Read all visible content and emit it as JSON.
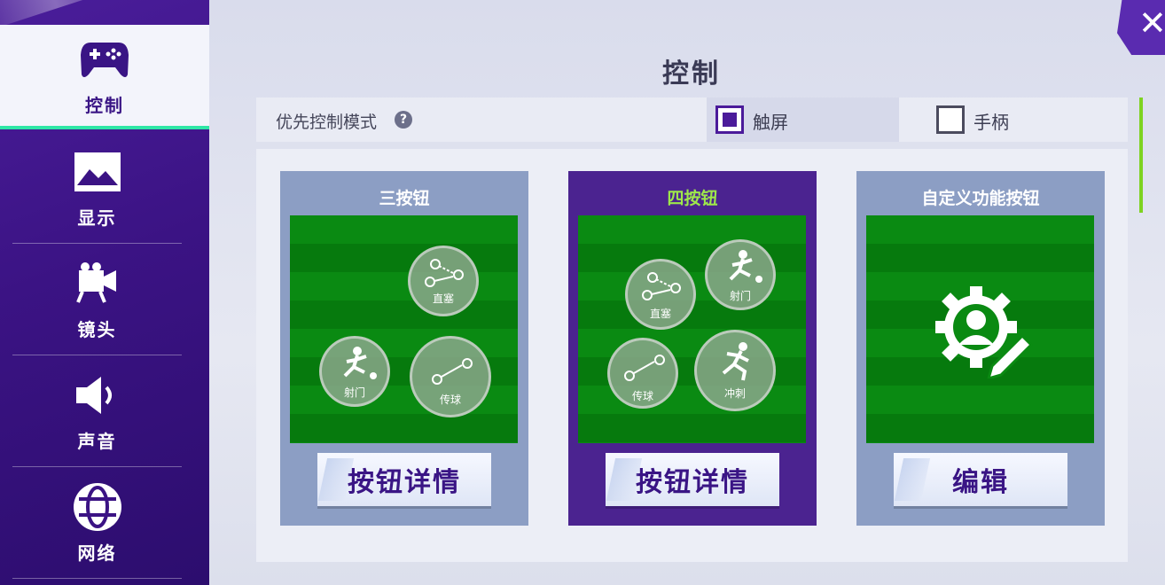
{
  "sidebar": {
    "items": [
      {
        "label": "控制",
        "icon": "gamepad-icon"
      },
      {
        "label": "显示",
        "icon": "image-icon"
      },
      {
        "label": "镜头",
        "icon": "camera-icon"
      },
      {
        "label": "声音",
        "icon": "speaker-icon"
      },
      {
        "label": "网络",
        "icon": "globe-icon"
      }
    ]
  },
  "header": {
    "title": "控制",
    "close_icon": "close-icon"
  },
  "mode": {
    "label": "优先控制模式",
    "help": "?",
    "options": [
      {
        "label": "触屏",
        "checked": true
      },
      {
        "label": "手柄",
        "checked": false
      }
    ]
  },
  "cards": [
    {
      "title": "三按钮",
      "button_label": "按钮详情",
      "field_buttons": [
        "直塞",
        "射门",
        "传球"
      ]
    },
    {
      "title": "四按钮",
      "button_label": "按钮详情",
      "field_buttons": [
        "直塞",
        "射门",
        "传球",
        "冲刺"
      ]
    },
    {
      "title": "自定义功能按钮",
      "button_label": "编辑",
      "icon": "gear-person-edit-icon"
    }
  ],
  "colors": {
    "sidebar": "#3b1384",
    "accent_green": "#9ee84a",
    "selected_card": "#4b2390",
    "card": "#8c9ec4",
    "field": "#0a8a12"
  }
}
